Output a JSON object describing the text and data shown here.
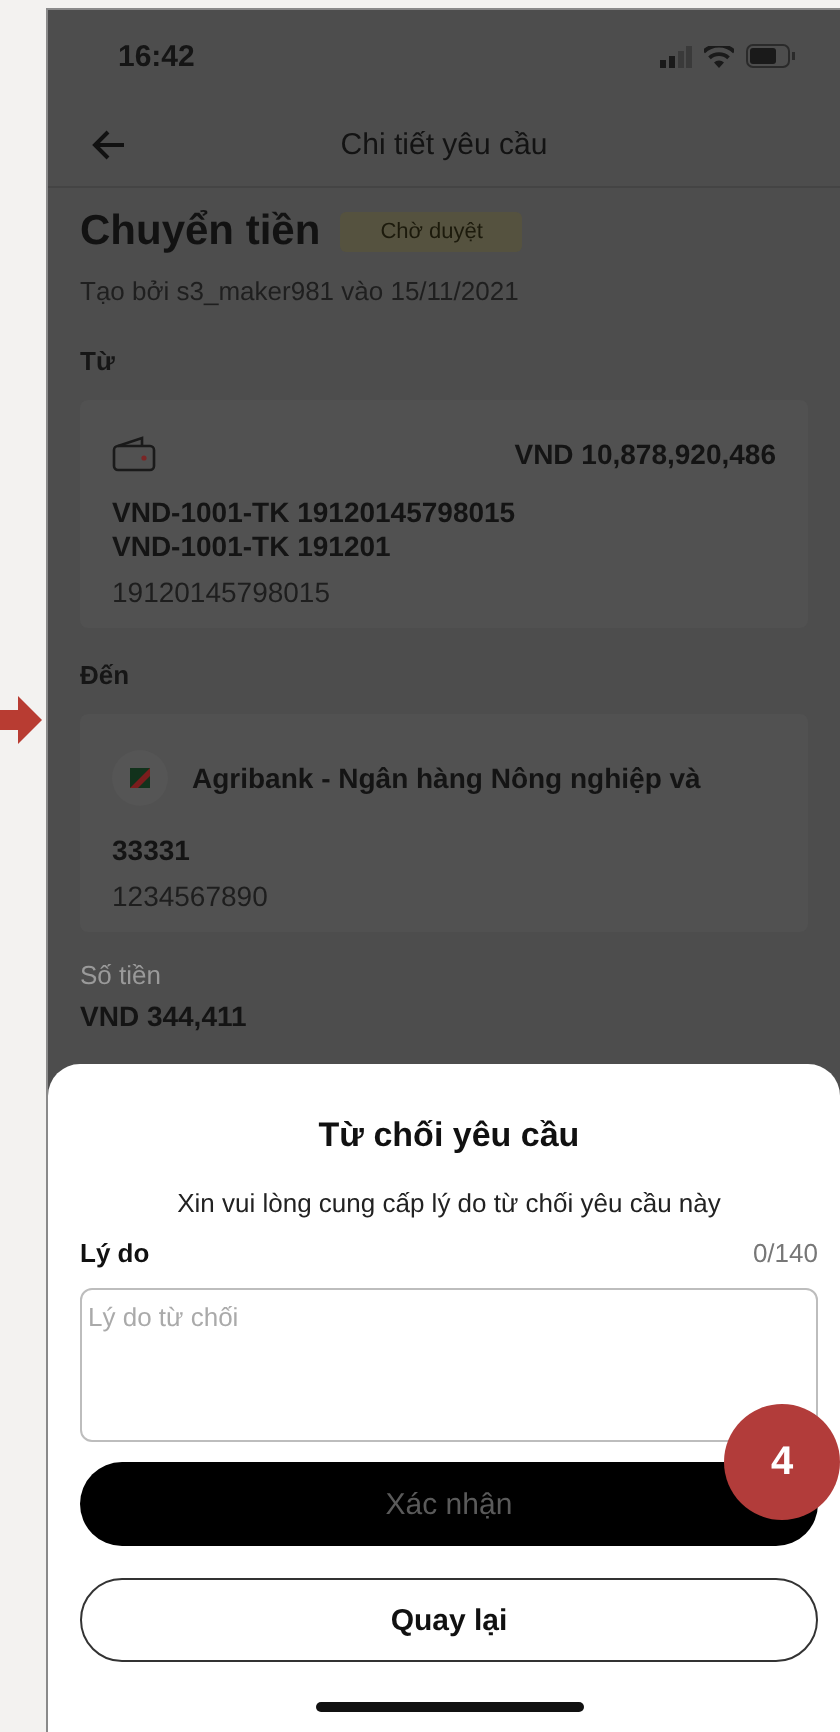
{
  "status_bar": {
    "time": "16:42"
  },
  "nav": {
    "title": "Chi tiết yêu cầu"
  },
  "request": {
    "title": "Chuyển tiền",
    "status": "Chờ duyệt",
    "created": "Tạo bởi s3_maker981 vào 15/11/2021"
  },
  "from": {
    "label": "Từ",
    "amount": "VND 10,878,920,486",
    "account_lines": [
      "VND-1001-TK 19120145798015",
      "VND-1001-TK 191201"
    ],
    "account_number": "19120145798015"
  },
  "to": {
    "label": "Đến",
    "bank": "Agribank - Ngân hàng Nông nghiệp và",
    "name": "33331",
    "account_number": "1234567890"
  },
  "amount": {
    "label": "Số tiền",
    "value": "VND 344,411"
  },
  "sheet": {
    "title": "Từ chối yêu cầu",
    "message": "Xin vui lòng cung cấp lý do từ chối yêu cầu này",
    "field_label": "Lý do",
    "counter": "0/140",
    "placeholder": "Lý do từ chối",
    "buttons": [
      {
        "label": "Xác nhận",
        "kind": "primary",
        "disabled": true
      },
      {
        "label": "Quay lại",
        "kind": "outline",
        "disabled": false
      }
    ]
  },
  "step_badge": "4"
}
